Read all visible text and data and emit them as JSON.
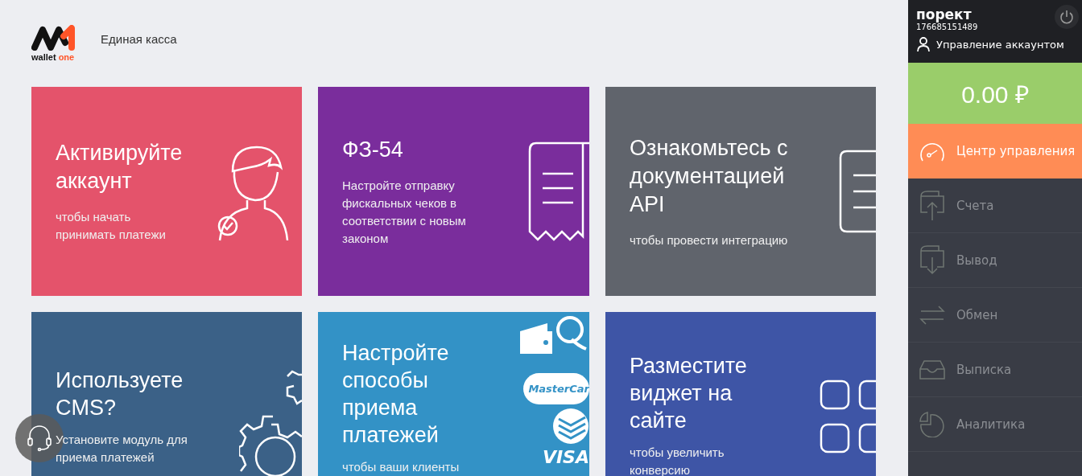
{
  "header": {
    "logo_text": {
      "main": "wallet",
      "accent": "one"
    },
    "title": "Единая касса"
  },
  "cards": [
    {
      "kind": "person",
      "color": "#e4536b",
      "title": "Активируйте аккаунт",
      "subtitle": "чтобы начать принимать платежи"
    },
    {
      "kind": "receipt",
      "color": "#7a2d9c",
      "title": "ФЗ-54",
      "subtitle": "Настройте отправку фискальных чеков в соответствии с новым законом"
    },
    {
      "kind": "document",
      "color": "#60646c",
      "title": "Ознакомьтесь с документацией API",
      "subtitle": "чтобы провести интеграцию"
    },
    {
      "kind": "gear",
      "color": "#3b6187",
      "title": "Используете CMS?",
      "subtitle": "Установите модуль для приема платежей"
    },
    {
      "kind": "payments",
      "color": "#3392c6",
      "title": "Настройте способы приема платежей",
      "subtitle": "чтобы ваши клиенты",
      "logos": [
        "MasterCar",
        "VISA"
      ]
    },
    {
      "kind": "widgets",
      "color": "#3e55a6",
      "title": "Разместите виджет на сайте",
      "subtitle": "чтобы увеличить конверсию"
    }
  ],
  "sidebar": {
    "account_name": "порект",
    "account_id": "176685151489",
    "manage_link": "Управление аккаунтом",
    "balance": "0.00 ₽",
    "items": [
      {
        "kind": "gauge",
        "label": "Центр управления",
        "selected": true
      },
      {
        "kind": "wallet-up",
        "label": "Счета",
        "selected": false
      },
      {
        "kind": "wallet-down",
        "label": "Вывод",
        "selected": false
      },
      {
        "kind": "exchange",
        "label": "Обмен",
        "selected": false
      },
      {
        "kind": "tray",
        "label": "Выписка",
        "selected": false
      },
      {
        "kind": "pie",
        "label": "Аналитика",
        "selected": false
      }
    ]
  }
}
